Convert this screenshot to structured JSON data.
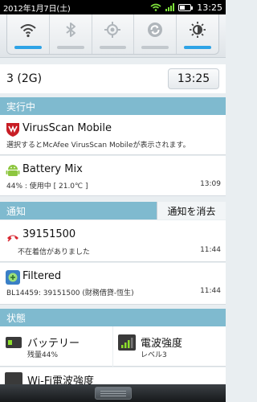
{
  "status_bar": {
    "date": "2012年1月7日(土)",
    "time": "13:25"
  },
  "toggles": [
    {
      "icon": "wifi-icon",
      "on": true
    },
    {
      "icon": "bluetooth-icon",
      "on": false
    },
    {
      "icon": "gps-icon",
      "on": false
    },
    {
      "icon": "sync-icon",
      "on": false
    },
    {
      "icon": "brightness-icon",
      "on": true
    }
  ],
  "network": {
    "label": "3 (2G)",
    "clock": "13:25"
  },
  "ongoing": {
    "header": "実行中"
  },
  "virusscan": {
    "title": "VirusScan Mobile",
    "desc": "選択するとMcAfee VirusScan Mobileが表示されます。"
  },
  "battery_mix": {
    "title": "Battery Mix",
    "desc": "44% : 使用中 [ 21.0℃ ]",
    "time": "13:09"
  },
  "notifications": {
    "header": "通知",
    "clear_label": "通知を消去"
  },
  "missed_call": {
    "title": "39151500",
    "desc": "不在着信がありました",
    "time": "11:44"
  },
  "filtered": {
    "title": "Filtered",
    "desc": "BL14459: 39151500 (財務借貸-恆生)",
    "time": "11:44"
  },
  "status": {
    "header": "状態"
  },
  "tiles": {
    "battery": {
      "title": "バッテリー",
      "sub": "残量44%"
    },
    "signal": {
      "title": "電波強度",
      "sub": "レベル3"
    },
    "wifi": {
      "title": "Wi-Fi電波強度"
    }
  },
  "colors": {
    "accent": "#2ea3e6",
    "header_bg": "#7fbacf",
    "signal_green": "#7ee23a"
  }
}
